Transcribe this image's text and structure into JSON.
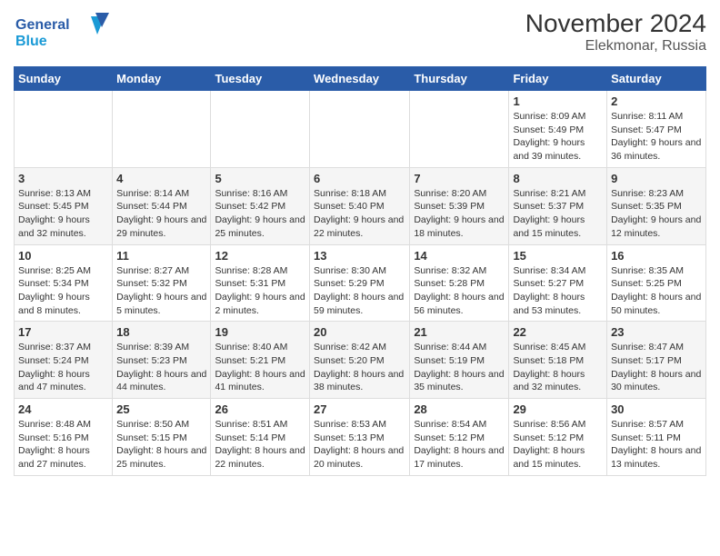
{
  "header": {
    "logo_line1": "General",
    "logo_line2": "Blue",
    "title": "November 2024",
    "subtitle": "Elekmonar, Russia"
  },
  "days_of_week": [
    "Sunday",
    "Monday",
    "Tuesday",
    "Wednesday",
    "Thursday",
    "Friday",
    "Saturday"
  ],
  "weeks": [
    [
      {
        "day": "",
        "info": ""
      },
      {
        "day": "",
        "info": ""
      },
      {
        "day": "",
        "info": ""
      },
      {
        "day": "",
        "info": ""
      },
      {
        "day": "",
        "info": ""
      },
      {
        "day": "1",
        "info": "Sunrise: 8:09 AM\nSunset: 5:49 PM\nDaylight: 9 hours and 39 minutes."
      },
      {
        "day": "2",
        "info": "Sunrise: 8:11 AM\nSunset: 5:47 PM\nDaylight: 9 hours and 36 minutes."
      }
    ],
    [
      {
        "day": "3",
        "info": "Sunrise: 8:13 AM\nSunset: 5:45 PM\nDaylight: 9 hours and 32 minutes."
      },
      {
        "day": "4",
        "info": "Sunrise: 8:14 AM\nSunset: 5:44 PM\nDaylight: 9 hours and 29 minutes."
      },
      {
        "day": "5",
        "info": "Sunrise: 8:16 AM\nSunset: 5:42 PM\nDaylight: 9 hours and 25 minutes."
      },
      {
        "day": "6",
        "info": "Sunrise: 8:18 AM\nSunset: 5:40 PM\nDaylight: 9 hours and 22 minutes."
      },
      {
        "day": "7",
        "info": "Sunrise: 8:20 AM\nSunset: 5:39 PM\nDaylight: 9 hours and 18 minutes."
      },
      {
        "day": "8",
        "info": "Sunrise: 8:21 AM\nSunset: 5:37 PM\nDaylight: 9 hours and 15 minutes."
      },
      {
        "day": "9",
        "info": "Sunrise: 8:23 AM\nSunset: 5:35 PM\nDaylight: 9 hours and 12 minutes."
      }
    ],
    [
      {
        "day": "10",
        "info": "Sunrise: 8:25 AM\nSunset: 5:34 PM\nDaylight: 9 hours and 8 minutes."
      },
      {
        "day": "11",
        "info": "Sunrise: 8:27 AM\nSunset: 5:32 PM\nDaylight: 9 hours and 5 minutes."
      },
      {
        "day": "12",
        "info": "Sunrise: 8:28 AM\nSunset: 5:31 PM\nDaylight: 9 hours and 2 minutes."
      },
      {
        "day": "13",
        "info": "Sunrise: 8:30 AM\nSunset: 5:29 PM\nDaylight: 8 hours and 59 minutes."
      },
      {
        "day": "14",
        "info": "Sunrise: 8:32 AM\nSunset: 5:28 PM\nDaylight: 8 hours and 56 minutes."
      },
      {
        "day": "15",
        "info": "Sunrise: 8:34 AM\nSunset: 5:27 PM\nDaylight: 8 hours and 53 minutes."
      },
      {
        "day": "16",
        "info": "Sunrise: 8:35 AM\nSunset: 5:25 PM\nDaylight: 8 hours and 50 minutes."
      }
    ],
    [
      {
        "day": "17",
        "info": "Sunrise: 8:37 AM\nSunset: 5:24 PM\nDaylight: 8 hours and 47 minutes."
      },
      {
        "day": "18",
        "info": "Sunrise: 8:39 AM\nSunset: 5:23 PM\nDaylight: 8 hours and 44 minutes."
      },
      {
        "day": "19",
        "info": "Sunrise: 8:40 AM\nSunset: 5:21 PM\nDaylight: 8 hours and 41 minutes."
      },
      {
        "day": "20",
        "info": "Sunrise: 8:42 AM\nSunset: 5:20 PM\nDaylight: 8 hours and 38 minutes."
      },
      {
        "day": "21",
        "info": "Sunrise: 8:44 AM\nSunset: 5:19 PM\nDaylight: 8 hours and 35 minutes."
      },
      {
        "day": "22",
        "info": "Sunrise: 8:45 AM\nSunset: 5:18 PM\nDaylight: 8 hours and 32 minutes."
      },
      {
        "day": "23",
        "info": "Sunrise: 8:47 AM\nSunset: 5:17 PM\nDaylight: 8 hours and 30 minutes."
      }
    ],
    [
      {
        "day": "24",
        "info": "Sunrise: 8:48 AM\nSunset: 5:16 PM\nDaylight: 8 hours and 27 minutes."
      },
      {
        "day": "25",
        "info": "Sunrise: 8:50 AM\nSunset: 5:15 PM\nDaylight: 8 hours and 25 minutes."
      },
      {
        "day": "26",
        "info": "Sunrise: 8:51 AM\nSunset: 5:14 PM\nDaylight: 8 hours and 22 minutes."
      },
      {
        "day": "27",
        "info": "Sunrise: 8:53 AM\nSunset: 5:13 PM\nDaylight: 8 hours and 20 minutes."
      },
      {
        "day": "28",
        "info": "Sunrise: 8:54 AM\nSunset: 5:12 PM\nDaylight: 8 hours and 17 minutes."
      },
      {
        "day": "29",
        "info": "Sunrise: 8:56 AM\nSunset: 5:12 PM\nDaylight: 8 hours and 15 minutes."
      },
      {
        "day": "30",
        "info": "Sunrise: 8:57 AM\nSunset: 5:11 PM\nDaylight: 8 hours and 13 minutes."
      }
    ]
  ]
}
